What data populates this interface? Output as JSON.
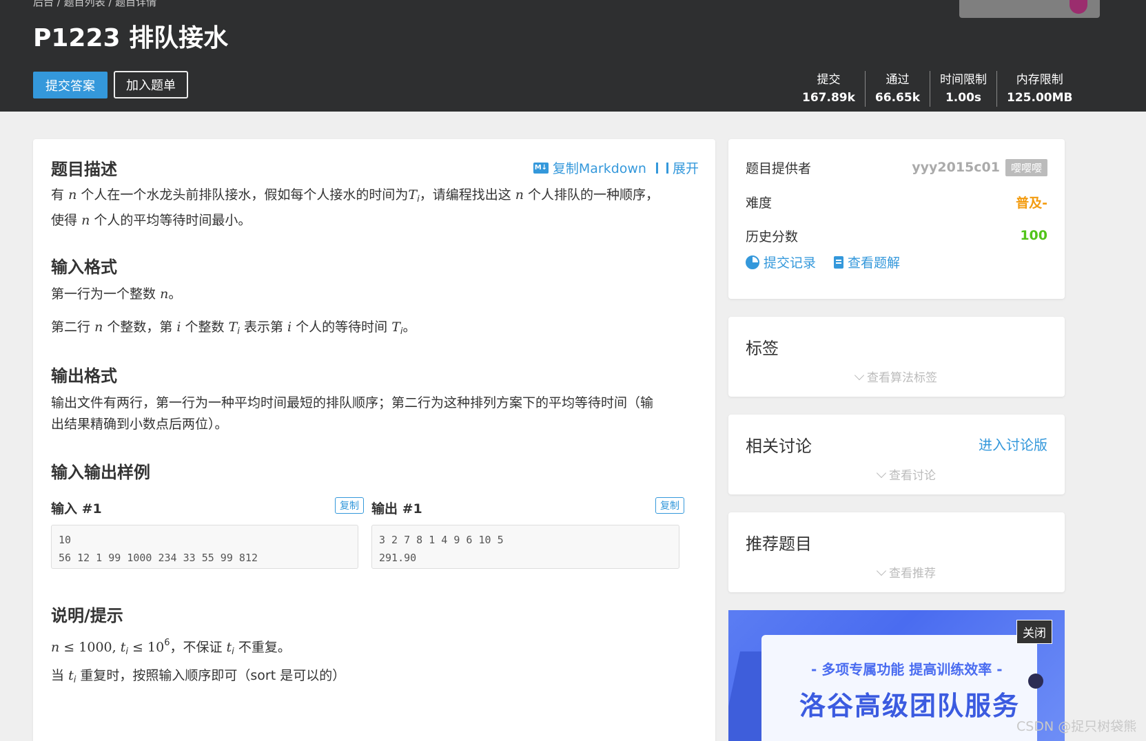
{
  "header": {
    "breadcrumb": "后台 / 题目列表 / 题目详情",
    "title": "P1223 排队接水",
    "submit_label": "提交答案",
    "add_label": "加入题单",
    "stats": [
      {
        "label": "提交",
        "value": "167.89k"
      },
      {
        "label": "通过",
        "value": "66.65k"
      },
      {
        "label": "时间限制",
        "value": "1.00s"
      },
      {
        "label": "内存限制",
        "value": "125.00MB"
      }
    ]
  },
  "problem": {
    "desc_title": "题目描述",
    "copy_markdown": "复制Markdown",
    "expand": "展开",
    "md_badge": "M↓",
    "desc_p1_a": "有",
    "desc_p1_b": "个人在一个水龙头前排队接水，假如每个人接水的时间为",
    "desc_p1_c": "，请编程找出这",
    "desc_p1_d": "个人排队的一种顺序，",
    "desc_p2_a": "使得",
    "desc_p2_b": "个人的平均等待时间最小。",
    "var_n": "n",
    "var_T": "T",
    "var_i": "i",
    "var_t": "t",
    "input_title": "输入格式",
    "input_p1_a": "第一行为一个整数",
    "input_p1_b": "。",
    "input_p2_a": "第二行",
    "input_p2_b": "个整数，第",
    "input_p2_c": "个整数",
    "input_p2_d": "表示第",
    "input_p2_e": "个人的等待时间",
    "input_p2_f": "。",
    "output_title": "输出格式",
    "output_p1": "输出文件有两行，第一行为一种平均时间最短的排队顺序；第二行为这种排列方案下的平均等待时间（输",
    "output_p2": "出结果精确到小数点后两位）。",
    "sample_title": "输入输出样例",
    "sample_in_label": "输入 #1",
    "sample_out_label": "输出 #1",
    "copy_label": "复制",
    "sample_in_line1": "10",
    "sample_in_line2": "56 12 1 99 1000 234 33 55 99 812",
    "sample_out_line1": "3 2 7 8 1 4 9 6 10 5",
    "sample_out_line2": "291.90",
    "hint_title": "说明/提示",
    "hint_le": "≤",
    "hint_1000": "1000,",
    "hint_10": "10",
    "hint_exp": "6",
    "hint_p1_tail_a": "，不保证",
    "hint_p1_tail_b": "不重复。",
    "hint_p2_a": "当",
    "hint_p2_b": "重复时，按照输入顺序即可（sort 是可以的）"
  },
  "sidebar": {
    "provider_label": "题目提供者",
    "provider_name": "yyy2015c01",
    "provider_badge": "嘤嘤嘤",
    "difficulty_label": "难度",
    "difficulty_value": "普及-",
    "score_label": "历史分数",
    "score_value": "100",
    "records_link": "提交记录",
    "solution_link": "查看题解",
    "tags_title": "标签",
    "tags_toggle": "查看算法标签",
    "discuss_title": "相关讨论",
    "discuss_link": "进入讨论版",
    "discuss_toggle": "查看讨论",
    "recommend_title": "推荐题目",
    "recommend_toggle": "查看推荐"
  },
  "ad": {
    "subtitle": "- 多项专属功能 提高训练效率 -",
    "title": "洛谷高级团队服务",
    "close": "关闭"
  },
  "watermark": "CSDN @捉只树袋熊",
  "colors": {
    "header_bg": "#2e2f30",
    "accent": "#3498db",
    "difficulty": "#f39c11",
    "score": "#52c41a"
  }
}
